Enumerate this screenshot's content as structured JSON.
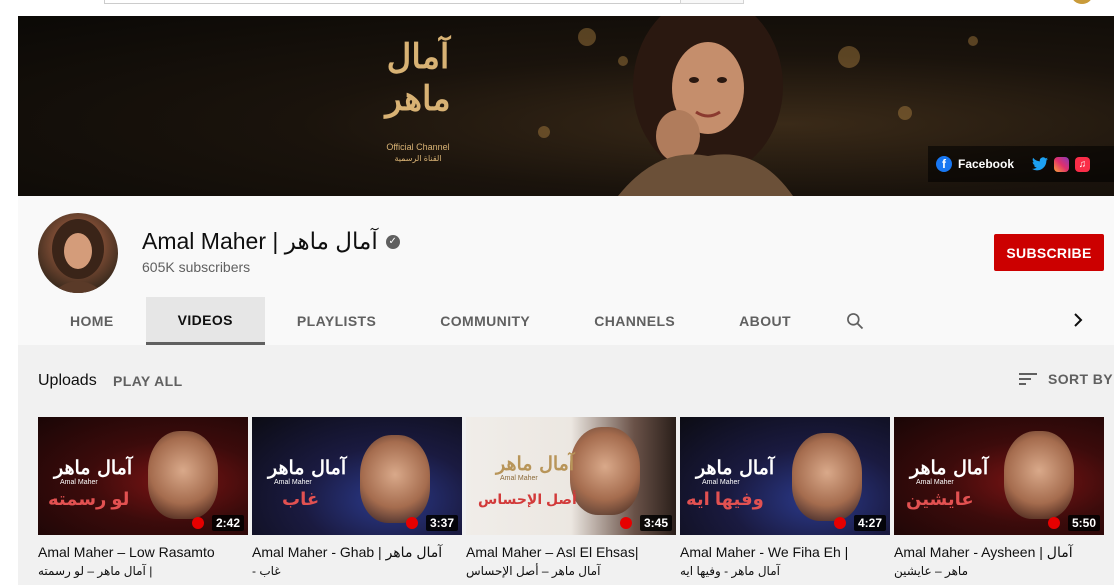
{
  "banner": {
    "logo_text": "آمال ماهر",
    "logo_sub1": "Official Channel",
    "logo_sub2": "القناة الرسمية",
    "link_label": "Facebook",
    "link_icons": [
      "facebook-icon",
      "twitter-icon",
      "instagram-icon",
      "apple-music-icon"
    ]
  },
  "channel": {
    "name": "Amal Maher | آمال ماهر",
    "subscribers": "605K subscribers",
    "subscribe_label": "SUBSCRIBE",
    "subscribe_color": "#cc0000"
  },
  "tabs": [
    {
      "label": "HOME"
    },
    {
      "label": "VIDEOS",
      "active": true
    },
    {
      "label": "PLAYLISTS"
    },
    {
      "label": "COMMUNITY"
    },
    {
      "label": "CHANNELS"
    },
    {
      "label": "ABOUT"
    }
  ],
  "section": {
    "title": "Uploads",
    "play_all": "PLAY ALL",
    "sort_by": "SORT BY"
  },
  "videos": [
    {
      "thumb_ar": "آمال ماهر",
      "thumb_en": "Amal Maher",
      "thumb_big": "لو رسمته",
      "duration": "2:42",
      "title1": "Amal Maher – Low Rasamto",
      "title2": "آمال ماهر – لو رسمته |"
    },
    {
      "thumb_ar": "آمال ماهر",
      "thumb_en": "Amal Maher",
      "thumb_big": "غاب",
      "duration": "3:37",
      "title1": "Amal Maher - Ghab | آمال ماهر",
      "title2": "- غاب"
    },
    {
      "thumb_ar": "آمال ماهر",
      "thumb_en": "Amal Maher",
      "thumb_big": "أصل الإحساس",
      "duration": "3:45",
      "title1": "Amal Maher – Asl El Ehsas|",
      "title2": "آمال ماهر – أصل الإحساس"
    },
    {
      "thumb_ar": "آمال ماهر",
      "thumb_en": "Amal Maher",
      "thumb_big": "وفيها ايه",
      "duration": "4:27",
      "title1": "Amal Maher - We Fiha Eh |",
      "title2": "آمال ماهر - وفيها ايه"
    },
    {
      "thumb_ar": "آمال ماهر",
      "thumb_en": "Amal Maher",
      "thumb_big": "عايشين",
      "duration": "5:50",
      "title1": "Amal Maher - Aysheen | آمال",
      "title2": "ماهر – عايشين"
    }
  ]
}
